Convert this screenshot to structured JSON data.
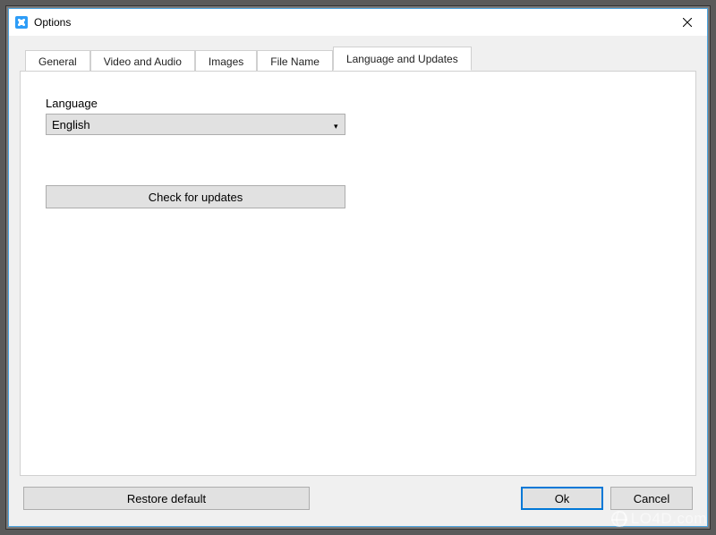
{
  "window": {
    "title": "Options"
  },
  "tabs": [
    {
      "label": "General"
    },
    {
      "label": "Video and Audio"
    },
    {
      "label": "Images"
    },
    {
      "label": "File Name"
    },
    {
      "label": "Language and Updates"
    }
  ],
  "panel": {
    "language_label": "Language",
    "language_value": "English",
    "check_updates_label": "Check for updates"
  },
  "footer": {
    "restore_label": "Restore default",
    "ok_label": "Ok",
    "cancel_label": "Cancel"
  },
  "watermark": "LO4D.com"
}
